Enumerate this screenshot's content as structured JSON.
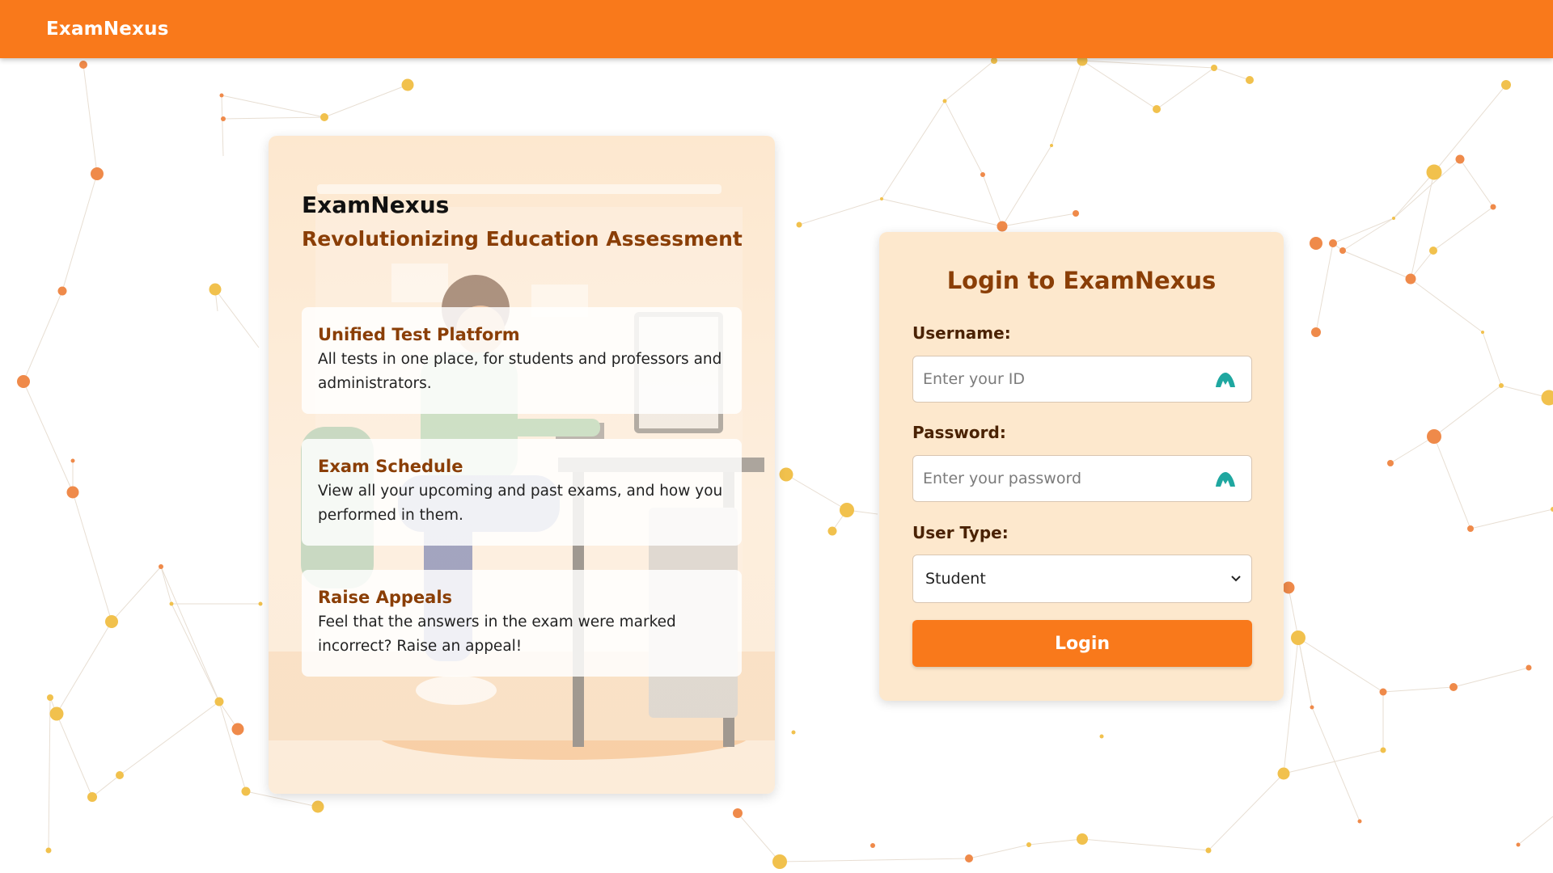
{
  "header": {
    "brand": "ExamNexus"
  },
  "info_card": {
    "title": "ExamNexus",
    "subtitle": "Revolutionizing Education Assessment",
    "features": [
      {
        "title": "Unified Test Platform",
        "description": "All tests in one place, for students and professors and administrators."
      },
      {
        "title": "Exam Schedule",
        "description": "View all your upcoming and past exams, and how you performed in them."
      },
      {
        "title": "Raise Appeals",
        "description": "Feel that the answers in the exam were marked incorrect? Raise an appeal!"
      }
    ]
  },
  "login": {
    "title": "Login to ExamNexus",
    "username_label": "Username:",
    "username_placeholder": "Enter your ID",
    "password_label": "Password:",
    "password_placeholder": "Enter your password",
    "user_type_label": "User Type:",
    "user_type_selected": "Student",
    "button_label": "Login",
    "field_icon": "teal-mountain-icon"
  },
  "colors": {
    "accent": "#f9791b",
    "title_brown": "#8a3e06",
    "card_bg": "#fde8cd",
    "network_orange": "#ef8a4a",
    "network_yellow": "#f1c14d",
    "icon_teal": "#1fa7a0"
  }
}
